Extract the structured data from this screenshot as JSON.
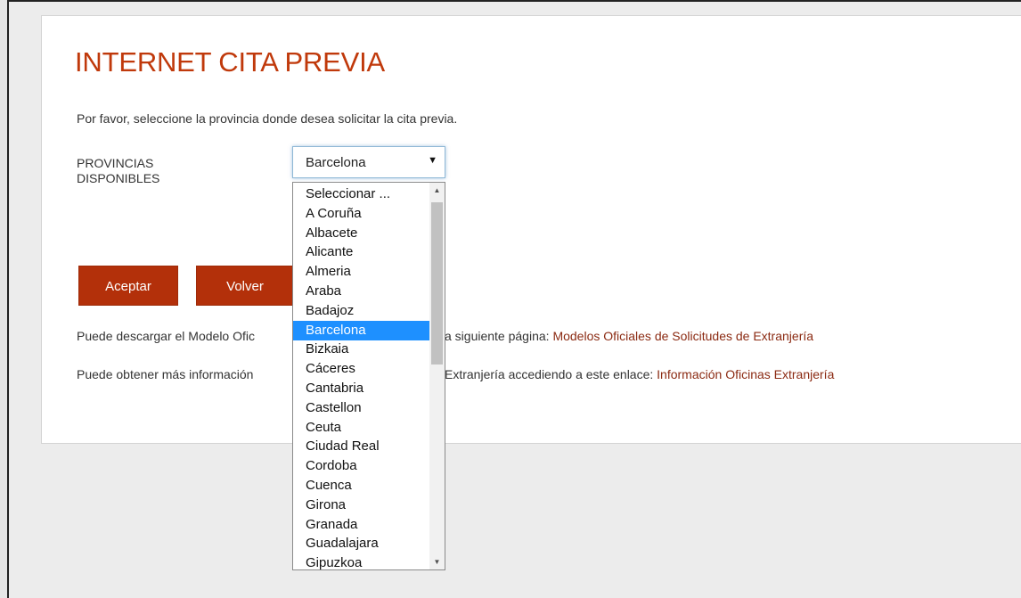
{
  "page": {
    "title": "INTERNET CITA PREVIA",
    "intro": "Por favor, seleccione la provincia donde desea solicitar la cita previa.",
    "provincias_label_line1": "PROVINCIAS",
    "provincias_label_line2": "DISPONIBLES"
  },
  "select": {
    "value": "Barcelona",
    "arrow_icon": "▼",
    "options": [
      "Seleccionar ...",
      "A Coruña",
      "Albacete",
      "Alicante",
      "Almeria",
      "Araba",
      "Badajoz",
      "Barcelona",
      "Bizkaia",
      "Cáceres",
      "Cantabria",
      "Castellon",
      "Ceuta",
      "Ciudad Real",
      "Cordoba",
      "Cuenca",
      "Girona",
      "Granada",
      "Guadalajara",
      "Gipuzkoa"
    ],
    "selected_index": 7,
    "highlight_color": "#1e90ff"
  },
  "buttons": {
    "accept": "Aceptar",
    "back": "Volver",
    "color": "#b3300a"
  },
  "info": {
    "line1_prefix": "Puede descargar el Modelo Ofic",
    "line1_middle": "a siguiente página: ",
    "line1_link": "Modelos Oficiales de Solicitudes de Extranjería",
    "line2_prefix": "Puede obtener más información",
    "line2_middle": "Extranjería accediendo a este enlace: ",
    "line2_link": "Información Oficinas Extranjería"
  },
  "colors": {
    "title": "#c0390b",
    "link": "#8b2a12"
  }
}
